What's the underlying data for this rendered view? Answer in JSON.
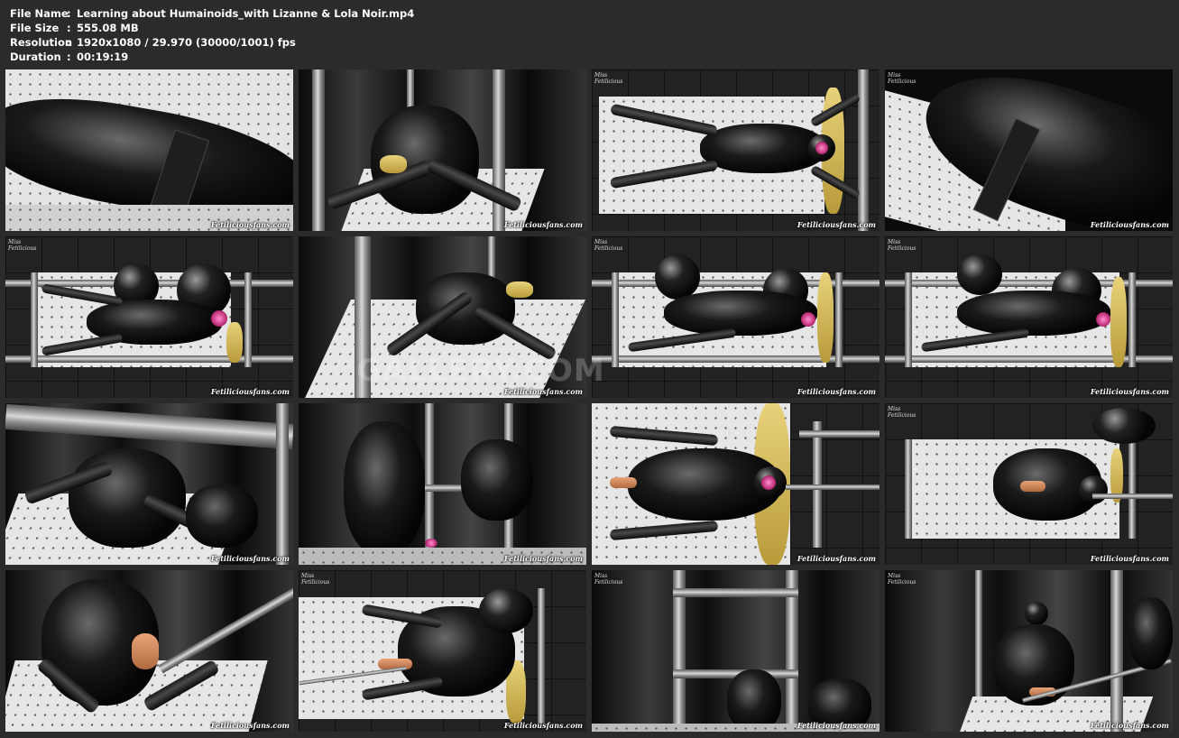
{
  "info": {
    "rows": [
      {
        "label": "File Name",
        "sep": ":",
        "value": "Learning about Humainoids_with Lizanne & Lola Noir.mp4"
      },
      {
        "label": "File Size",
        "sep": ":",
        "value": "555.08 MB"
      },
      {
        "label": "Resolution",
        "sep": ":",
        "value": "1920x1080 / 29.970 (30000/1001) fps"
      },
      {
        "label": "Duration",
        "sep": ":",
        "value": "00:19:19"
      }
    ]
  },
  "thumbnail_watermark": "Fetiliciousfans.com",
  "logo_text": "Miss Fetilicious",
  "overlay_watermark": "GALLERY.COM",
  "colors": {
    "background": "#2b2b2b",
    "text": "#ffffff"
  }
}
